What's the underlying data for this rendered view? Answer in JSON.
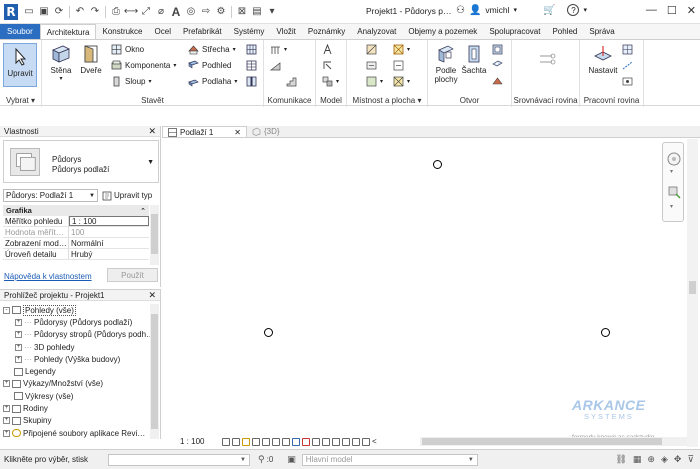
{
  "titlebar": {
    "logo": "R",
    "title": "Projekt1 - Půdorys p…",
    "user": "vmichl",
    "help": "?"
  },
  "tabs": [
    {
      "label": "Soubor",
      "kind": "file"
    },
    {
      "label": "Architektura",
      "kind": "active"
    },
    {
      "label": "Konstrukce",
      "kind": ""
    },
    {
      "label": "Ocel",
      "kind": ""
    },
    {
      "label": "Prefabrikát",
      "kind": ""
    },
    {
      "label": "Systémy",
      "kind": ""
    },
    {
      "label": "Vložit",
      "kind": ""
    },
    {
      "label": "Poznámky",
      "kind": ""
    },
    {
      "label": "Analyzovat",
      "kind": ""
    },
    {
      "label": "Objemy a pozemek",
      "kind": ""
    },
    {
      "label": "Spolupracovat",
      "kind": ""
    },
    {
      "label": "Pohled",
      "kind": ""
    },
    {
      "label": "Správa",
      "kind": ""
    }
  ],
  "ribbon": {
    "select": {
      "modify": "Upravit",
      "label": "Vybrat"
    },
    "build": {
      "wall": "Stěna",
      "door": "Dveře",
      "window": "Okno",
      "component": "Komponenta",
      "column": "Sloup",
      "roof": "Střecha",
      "ceiling": "Podhled",
      "floor": "Podlaha",
      "label": "Stavět"
    },
    "circulation": {
      "label": "Komunikace"
    },
    "model": {
      "label": "Model"
    },
    "room": {
      "label": "Místnost a plocha"
    },
    "opening": {
      "by_face": "Podle plochy",
      "shaft": "Šachta",
      "label": "Otvor"
    },
    "datum": {
      "label": "Srovnávací rovina"
    },
    "workplane": {
      "set": "Nastavit",
      "label": "Pracovní rovina"
    }
  },
  "properties": {
    "title": "Vlastnosti",
    "type_line1": "Půdorys",
    "type_line2": "Půdorys podlaží",
    "instance": "Půdorys: Podlaží 1",
    "edit_type": "Upravit typ",
    "category": "Grafika",
    "rows": [
      {
        "key": "Měřítko pohledu",
        "value": "1 : 100",
        "dim": false
      },
      {
        "key": "Hodnota měřít…",
        "value": "100",
        "dim": true
      },
      {
        "key": "Zobrazení mod…",
        "value": "Normální",
        "dim": false
      },
      {
        "key": "Úroveň detailu",
        "value": "Hrubý",
        "dim": false
      }
    ],
    "help": "Nápověda k vlastnostem",
    "apply": "Použít"
  },
  "browser": {
    "title": "Prohlížeč projektu - Projekt1",
    "items": [
      {
        "label": "Pohledy (vše)",
        "level": 0,
        "box": "-"
      },
      {
        "label": "Půdorysy (Půdorys podlaží)",
        "level": 1,
        "box": "+"
      },
      {
        "label": "Půdorysy stropů (Půdorys podh…",
        "level": 1,
        "box": "+"
      },
      {
        "label": "3D pohledy",
        "level": 1,
        "box": "+"
      },
      {
        "label": "Pohledy (Výška budovy)",
        "level": 1,
        "box": "+"
      },
      {
        "label": "Legendy",
        "level": 0,
        "box": ""
      },
      {
        "label": "Výkazy/Množství (vše)",
        "level": 0,
        "box": "+"
      },
      {
        "label": "Výkresy (vše)",
        "level": 0,
        "box": ""
      },
      {
        "label": "Rodiny",
        "level": 0,
        "box": "+"
      },
      {
        "label": "Skupiny",
        "level": 0,
        "box": "+"
      },
      {
        "label": "Připojené soubory aplikace Revi…",
        "level": 0,
        "box": "∞"
      }
    ]
  },
  "views": {
    "active": "Podlaží 1",
    "inactive": "{3D}",
    "scale": "1 : 100"
  },
  "watermark": {
    "brand": "ARKANCE",
    "sub": "SYSTEMS",
    "small": "formerly known as cadstudio"
  },
  "status": {
    "message": "Klikněte pro výběr, stisk",
    "workset_value": ":0",
    "model": "Hlavní model"
  }
}
